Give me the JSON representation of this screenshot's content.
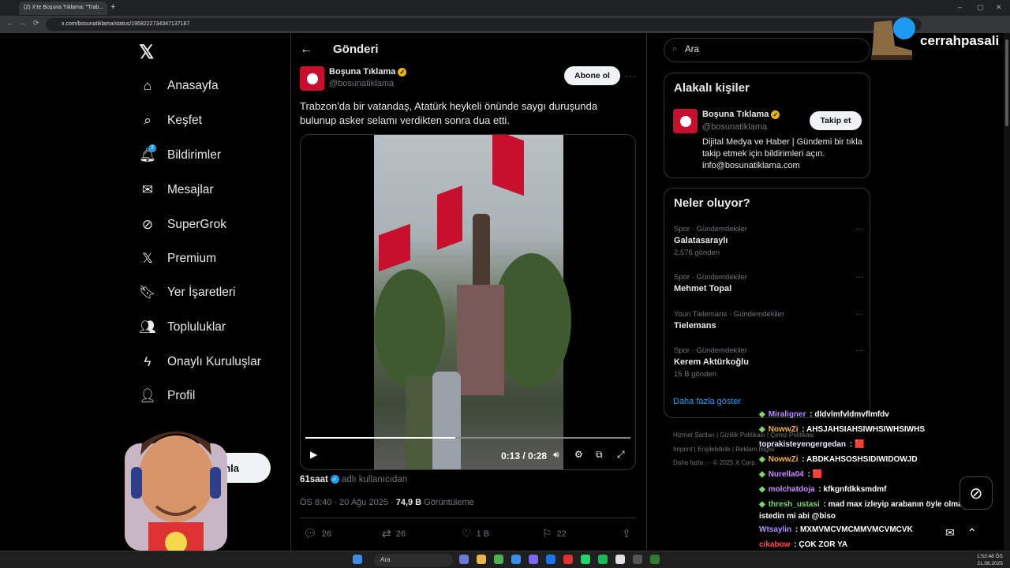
{
  "browser": {
    "tab_title": "(2) X'te Boşuna Tıklama: \"Trab...",
    "url": "x.com/bosunatiklama/status/1958222734347137167"
  },
  "sidebar": {
    "items": [
      {
        "label": "Anasayfa",
        "icon": "home-icon"
      },
      {
        "label": "Keşfet",
        "icon": "search-icon"
      },
      {
        "label": "Bildirimler",
        "icon": "bell-icon"
      },
      {
        "label": "Mesajlar",
        "icon": "mail-icon"
      },
      {
        "label": "SuperGrok",
        "icon": "grok-icon"
      },
      {
        "label": "Premium",
        "icon": "x-icon"
      },
      {
        "label": "Yer İşaretleri",
        "icon": "bookmark-icon"
      },
      {
        "label": "Topluluklar",
        "icon": "communities-icon"
      },
      {
        "label": "Onaylı Kuruluşlar",
        "icon": "lightning-icon"
      },
      {
        "label": "Profil",
        "icon": "person-icon"
      }
    ],
    "notification_count": "2",
    "post_button_partial": "ınla"
  },
  "main": {
    "header_title": "Gönderi",
    "author_name": "Boşuna Tıklama",
    "author_handle": "@bosunatiklama",
    "subscribe_label": "Abone ol",
    "tweet_text": "Trabzon'da bir vatandaş, Atatürk heykeli önünde saygı duruşunda bulunup asker selamı verdikten sonra dua etti.",
    "video_time": "0:13 / 0:28",
    "video_progress": 0.46,
    "from_user": "61saat",
    "from_suffix": "adlı kullanıcıdan",
    "timestamp": "ÖS 8:40 · 20 Ağu 2025 · ",
    "views_count": "74,9 B",
    "views_label": " Görüntüleme",
    "replies": "26",
    "reposts": "26",
    "likes": "1 B",
    "bookmarks": "22"
  },
  "right": {
    "search_placeholder": "Ara",
    "related_title": "Alakalı kişiler",
    "related_name": "Boşuna Tıklama",
    "related_handle": "@bosunatiklama",
    "follow_label": "Takip et",
    "related_bio": "Dijital Medya ve Haber | Gündemi bir tıkla takip etmek için bildirimleri açın. info@bosunatiklama.com",
    "trends_title": "Neler oluyor?",
    "trends": [
      {
        "category": "Spor · Gündemdekiler",
        "title": "Galatasaraylı",
        "count": "2.576 gönderi"
      },
      {
        "category": "Spor · Gündemdekiler",
        "title": "Mehmet Topal",
        "count": ""
      },
      {
        "category": "Youri Tielemans · Gündemdekiler",
        "title": "Tielemans",
        "count": ""
      },
      {
        "category": "Spor · Gündemdekiler",
        "title": "Kerem Aktürkoğlu",
        "count": "15 B gönderi"
      }
    ],
    "show_more": "Daha fazla göster",
    "footer_line1": "Hizmet Şartları   |   Gizlilik Politikası   |   Çerez Politikası",
    "footer_line2": "Imprint   |   Erişilebilirlik   |   Reklam bilgisi",
    "footer_line3": "Daha fazla ···   © 2025 X Corp."
  },
  "overlay": {
    "streamer_name": "cerrahpasali",
    "chat": [
      {
        "user": "Miraligner",
        "color": "#b58cff",
        "msg": "dldvlmfvldmvflmfdv"
      },
      {
        "user": "NowwZi",
        "color": "#ffb22e",
        "msg": "AHSJAHSIAHSIWHSIWHSIWHS"
      },
      {
        "user": "toprakisteyengergedan",
        "color": "#e6e6ff",
        "msg": "🟥"
      },
      {
        "user": "NowwZi",
        "color": "#ffb22e",
        "msg": "ABDKAHSOSHSIDIWIDOWJD"
      },
      {
        "user": "Nurella04",
        "color": "#c98cff",
        "msg": "🟥"
      },
      {
        "user": "molchatdoja",
        "color": "#c98cff",
        "msg": "kfkgnfdkksmdmf"
      },
      {
        "user": "thresh_ustasi",
        "color": "#7cd66d",
        "msg": "mad max izleyip arabanın öyle olmasını istedin mi abi @biso"
      },
      {
        "user": "Wtsaylin",
        "color": "#b58cff",
        "msg": "MXMVMCVMCMMVMCVMCVK"
      },
      {
        "user": "cikabow",
        "color": "#ff4b4b",
        "msg": "ÇOK ZOR YA"
      }
    ]
  },
  "taskbar": {
    "search": "Ara",
    "time": "1:53:48 ÖS",
    "date": "21.08.2025"
  }
}
